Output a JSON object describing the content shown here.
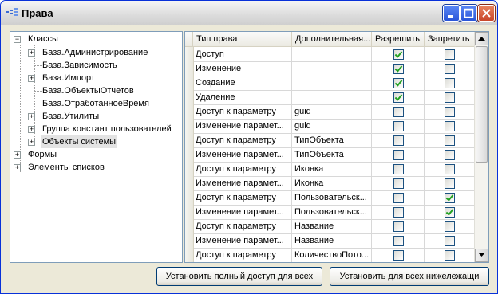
{
  "window": {
    "title": "Права"
  },
  "tree": {
    "items": [
      {
        "label": "Классы",
        "expander": "−",
        "level": 0
      },
      {
        "label": "База.Администрирование",
        "expander": "+",
        "level": 1
      },
      {
        "label": "База.Зависимость",
        "expander": "",
        "level": 1
      },
      {
        "label": "База.Импорт",
        "expander": "+",
        "level": 1
      },
      {
        "label": "База.ОбъектыОтчетов",
        "expander": "",
        "level": 1
      },
      {
        "label": "База.ОтработанноеВремя",
        "expander": "",
        "level": 1
      },
      {
        "label": "База.Утилиты",
        "expander": "+",
        "level": 1
      },
      {
        "label": "Группа констант пользователей",
        "expander": "+",
        "level": 1
      },
      {
        "label": "Объекты системы",
        "expander": "+",
        "level": 1,
        "selected": true
      },
      {
        "label": "Формы",
        "expander": "+",
        "level": 0
      },
      {
        "label": "Элементы списков",
        "expander": "+",
        "level": 0
      }
    ]
  },
  "grid": {
    "columns": [
      "Тип права",
      "Дополнительная...",
      "Разрешить",
      "Запретить"
    ],
    "rows": [
      {
        "type": "Доступ",
        "extra": "",
        "allow": true,
        "deny": false
      },
      {
        "type": "Изменение",
        "extra": "",
        "allow": true,
        "deny": false
      },
      {
        "type": "Создание",
        "extra": "",
        "allow": true,
        "deny": false
      },
      {
        "type": "Удаление",
        "extra": "",
        "allow": true,
        "deny": false
      },
      {
        "type": "Доступ к параметру",
        "extra": "guid",
        "allow": false,
        "deny": false
      },
      {
        "type": "Изменение парамет...",
        "extra": "guid",
        "allow": false,
        "deny": false
      },
      {
        "type": "Доступ к параметру",
        "extra": "ТипОбъекта",
        "allow": false,
        "deny": false
      },
      {
        "type": "Изменение парамет...",
        "extra": "ТипОбъекта",
        "allow": false,
        "deny": false
      },
      {
        "type": "Доступ к параметру",
        "extra": "Иконка",
        "allow": false,
        "deny": false
      },
      {
        "type": "Изменение парамет...",
        "extra": "Иконка",
        "allow": false,
        "deny": false
      },
      {
        "type": "Доступ к параметру",
        "extra": "Пользовательск...",
        "allow": false,
        "deny": true
      },
      {
        "type": "Изменение парамет...",
        "extra": "Пользовательск...",
        "allow": false,
        "deny": true
      },
      {
        "type": "Доступ к параметру",
        "extra": "Название",
        "allow": false,
        "deny": false
      },
      {
        "type": "Изменение парамет...",
        "extra": "Название",
        "allow": false,
        "deny": false
      },
      {
        "type": "Доступ к параметру",
        "extra": "КоличествоПото...",
        "allow": false,
        "deny": false
      }
    ]
  },
  "buttons": {
    "full_access": "Установить полный доступ для всех",
    "set_below": "Установить для всех нижележащи"
  },
  "icons": {
    "minimize": "minimize-icon",
    "maximize": "maximize-icon",
    "close": "close-icon",
    "scroll_up": "arrow-up-icon",
    "scroll_down": "arrow-down-icon"
  }
}
